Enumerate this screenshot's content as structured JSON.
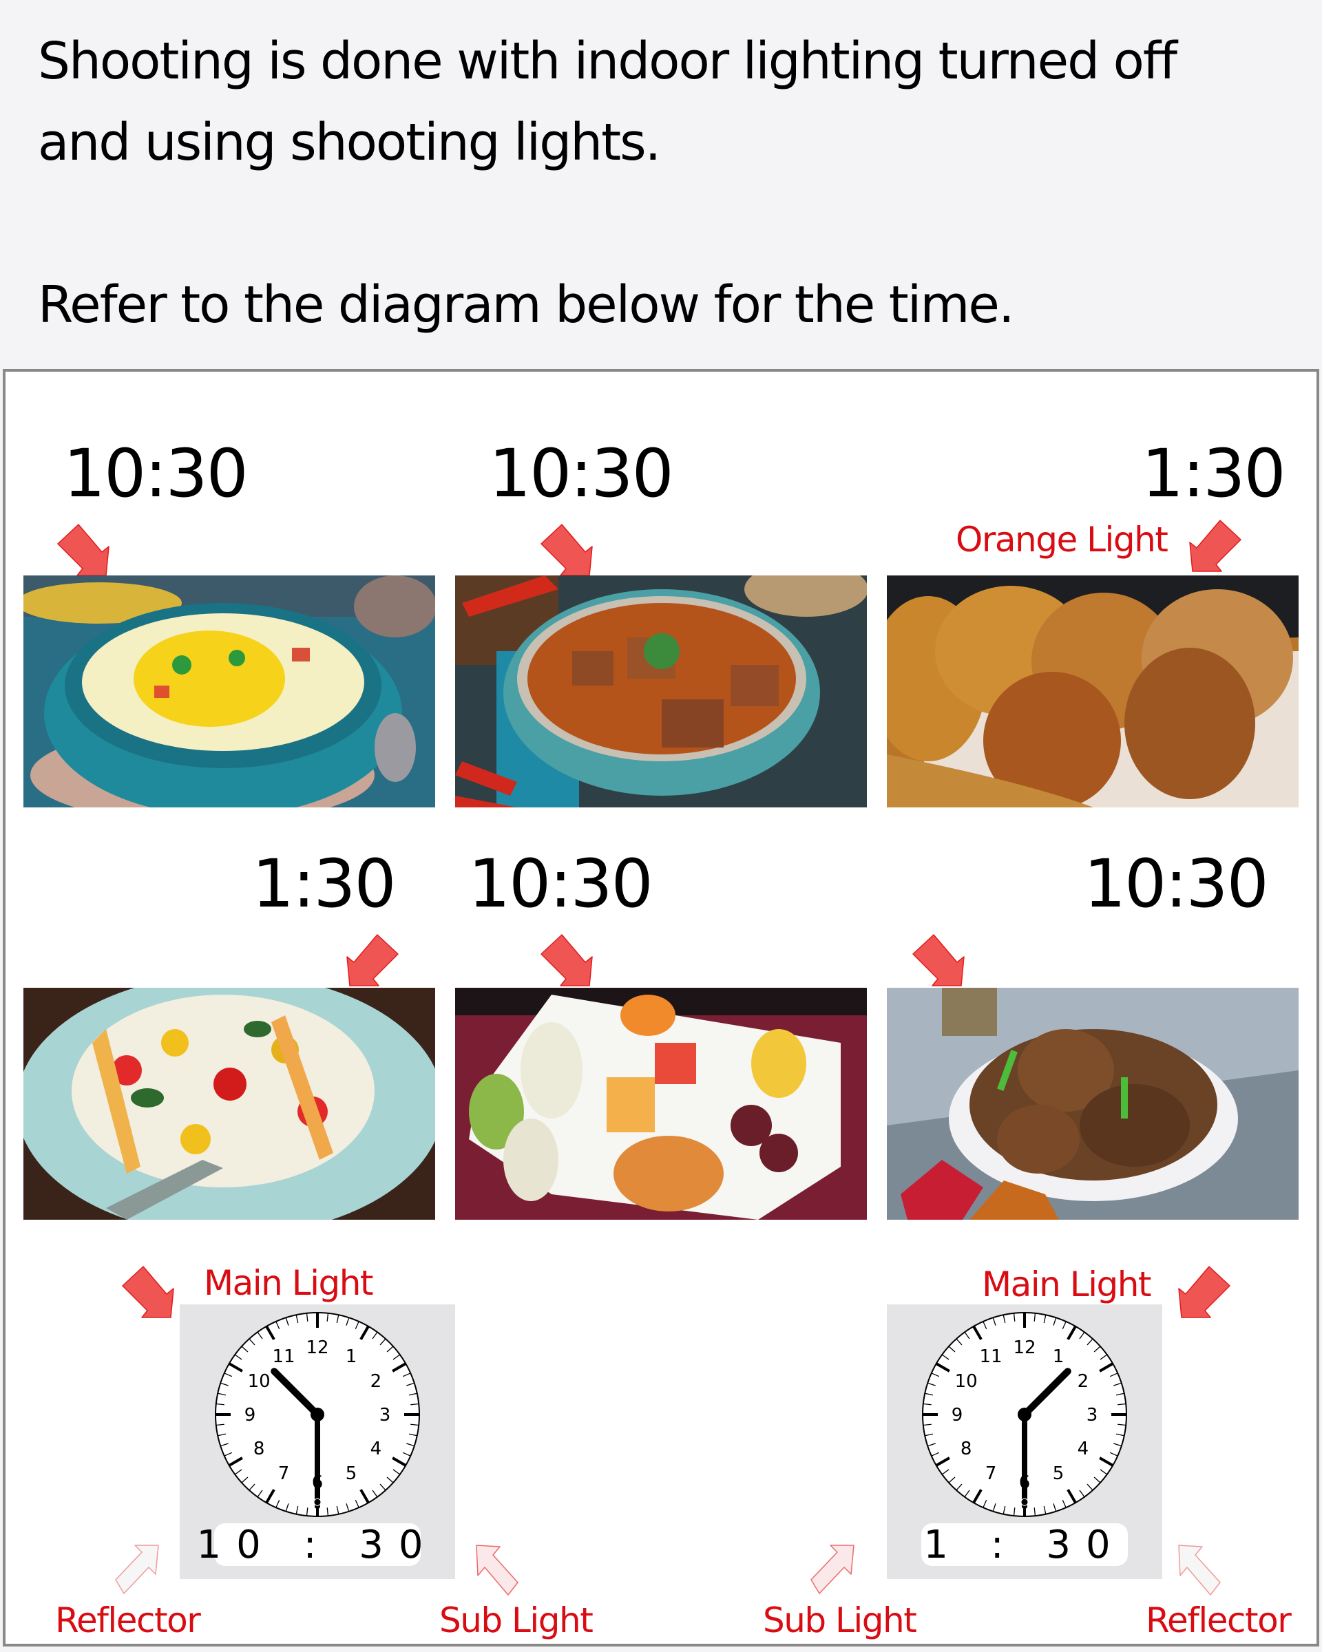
{
  "intro": {
    "line1": "Shooting is done with indoor lighting turned off",
    "line2": "and using shooting lights.",
    "line3": "Refer to the diagram below for the time."
  },
  "colors": {
    "accent_red": "#d80c12",
    "arrow_red": "#ee5553",
    "panel_border": "#888888",
    "clock_box": "#e4e4e6",
    "page_bg": "#f4f4f6"
  },
  "dishes": [
    {
      "time": "10:30",
      "description": "corn chowder in teal bowl",
      "arrow": "down-right",
      "arrow_icon": "arrow-down-right-icon"
    },
    {
      "time": "10:30",
      "description": "beef curry stew in teal pot",
      "arrow": "down-right",
      "arrow_icon": "arrow-down-right-icon"
    },
    {
      "time": "1:30",
      "description": "crusty bread rolls in basket",
      "arrow": "down-left",
      "arrow_icon": "arrow-down-left-icon",
      "extra_label": "Orange Light"
    },
    {
      "time": "1:30",
      "description": "tomato and cheese salad platter",
      "arrow": "down-left",
      "arrow_icon": "arrow-down-left-icon"
    },
    {
      "time": "10:30",
      "description": "fruit and chicken roll plate",
      "arrow": "down-right",
      "arrow_icon": "arrow-down-right-icon"
    },
    {
      "time": "10:30",
      "description": "braised pork ribs in white bowl",
      "arrow": "down-right",
      "arrow_icon": "arrow-down-right-icon"
    }
  ],
  "clocks": [
    {
      "digital": "10 : 30",
      "hour": 10,
      "minute": 30,
      "main_light": "Main Light",
      "sub_light": "Sub Light",
      "reflector": "Reflector",
      "numerals": [
        "12",
        "1",
        "2",
        "3",
        "4",
        "5",
        "6",
        "7",
        "8",
        "9",
        "10",
        "11"
      ]
    },
    {
      "digital": "1 : 30",
      "hour": 1,
      "minute": 30,
      "main_light": "Main Light",
      "sub_light": "Sub Light",
      "reflector": "Reflector",
      "numerals": [
        "12",
        "1",
        "2",
        "3",
        "4",
        "5",
        "6",
        "7",
        "8",
        "9",
        "10",
        "11"
      ]
    }
  ]
}
